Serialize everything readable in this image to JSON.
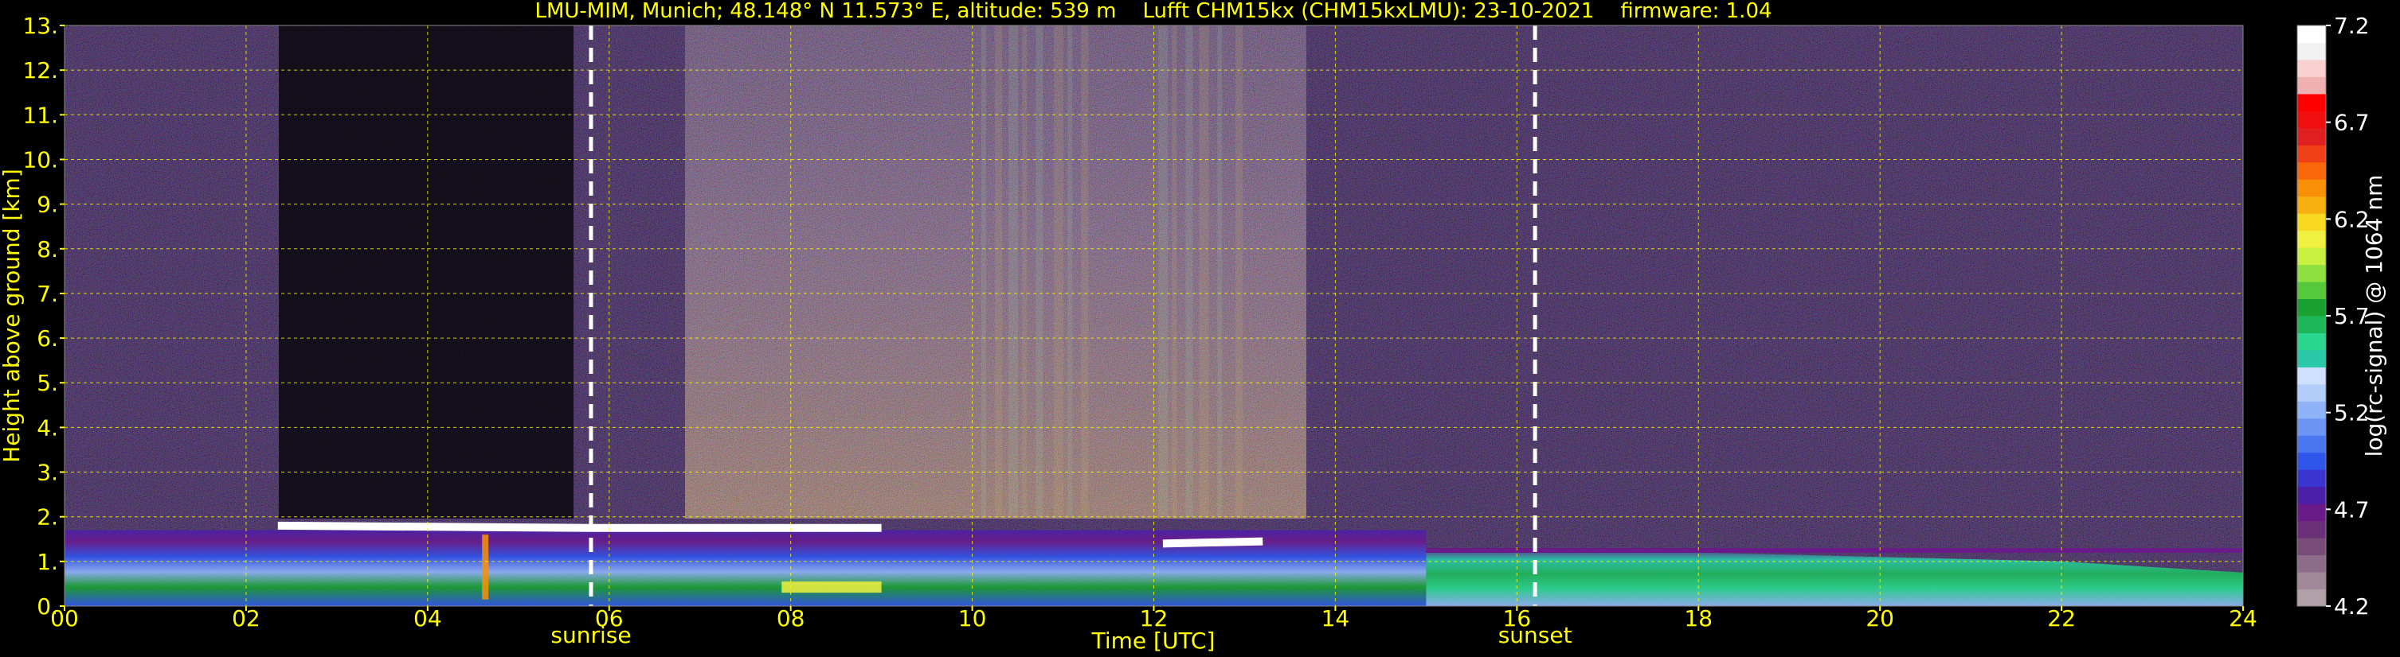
{
  "chart_data": {
    "type": "heatmap",
    "title": "LMU-MIM, Munich; 48.148° N 11.573° E, altitude: 539 m    Lufft CHM15kx (CHM15kxLMU): 23-10-2021    firmware: 1.04",
    "xlabel": "Time [UTC]",
    "ylabel": "Height above ground [km]",
    "xlim": [
      0,
      24
    ],
    "ylim": [
      0,
      13
    ],
    "x_ticks": [
      "00",
      "02",
      "04",
      "06",
      "08",
      "10",
      "12",
      "14",
      "16",
      "18",
      "20",
      "22",
      "24"
    ],
    "y_ticks": [
      "0.",
      "1.",
      "2.",
      "3.",
      "4.",
      "5.",
      "6.",
      "7.",
      "8.",
      "9.",
      "10.",
      "11.",
      "12.",
      "13."
    ],
    "grid": true,
    "grid_color": "#ffff00",
    "axis_text_color": "#ffff00",
    "background": "#000000",
    "markers": [
      {
        "label": "sunrise",
        "time": 5.8
      },
      {
        "label": "sunset",
        "time": 16.2
      }
    ],
    "colorbar": {
      "label": "log(rc-signal) @ 1064 nm",
      "range": [
        4.2,
        7.2
      ],
      "ticks": [
        "4.2",
        "4.7",
        "5.2",
        "5.7",
        "6.2",
        "6.7",
        "7.2"
      ],
      "colors": [
        "#b0a0a8",
        "#a08898",
        "#8c6c88",
        "#784c78",
        "#6a2f76",
        "#6a1b8a",
        "#4b1fa8",
        "#3a34d0",
        "#2f55ea",
        "#4a76f0",
        "#6c95f5",
        "#8fb3f8",
        "#b3cdfa",
        "#cfe0ff",
        "#28c8a8",
        "#2bd78f",
        "#1eb85a",
        "#18a030",
        "#55c83c",
        "#8ee040",
        "#c8f040",
        "#f0f040",
        "#f8d820",
        "#f8b010",
        "#f89008",
        "#f86808",
        "#f04018",
        "#e02020",
        "#f01010",
        "#ff0000",
        "#f0b0b0",
        "#f8d0d0",
        "#f2f2f2",
        "#ffffff"
      ]
    }
  }
}
